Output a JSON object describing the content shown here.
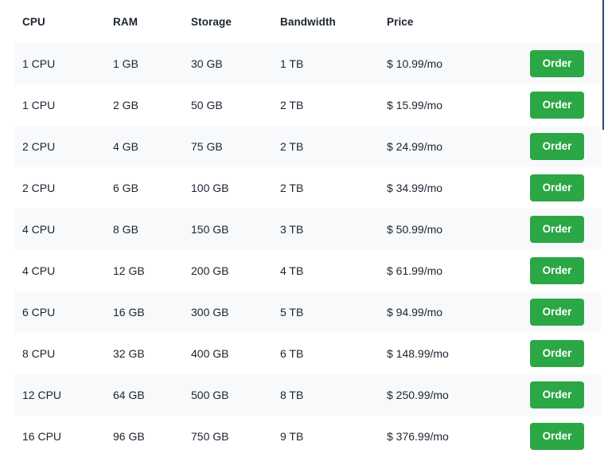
{
  "table": {
    "columns": [
      {
        "key": "cpu",
        "label": "CPU"
      },
      {
        "key": "ram",
        "label": "RAM"
      },
      {
        "key": "storage",
        "label": "Storage"
      },
      {
        "key": "bandwidth",
        "label": "Bandwidth"
      },
      {
        "key": "price",
        "label": "Price"
      },
      {
        "key": "action",
        "label": ""
      }
    ],
    "order_button_label": "Order",
    "rows": [
      {
        "cpu": "1 CPU",
        "ram": "1 GB",
        "storage": "30 GB",
        "bandwidth": "1 TB",
        "price": "$ 10.99/mo",
        "action": "Order"
      },
      {
        "cpu": "1 CPU",
        "ram": "2 GB",
        "storage": "50 GB",
        "bandwidth": "2 TB",
        "price": "$ 15.99/mo",
        "action": "Order"
      },
      {
        "cpu": "2 CPU",
        "ram": "4 GB",
        "storage": "75 GB",
        "bandwidth": "2 TB",
        "price": "$ 24.99/mo",
        "action": "Order"
      },
      {
        "cpu": "2 CPU",
        "ram": "6 GB",
        "storage": "100 GB",
        "bandwidth": "2 TB",
        "price": "$ 34.99/mo",
        "action": "Order"
      },
      {
        "cpu": "4 CPU",
        "ram": "8 GB",
        "storage": "150 GB",
        "bandwidth": "3 TB",
        "price": "$ 50.99/mo",
        "action": "Order"
      },
      {
        "cpu": "4 CPU",
        "ram": "12 GB",
        "storage": "200 GB",
        "bandwidth": "4 TB",
        "price": "$ 61.99/mo",
        "action": "Order"
      },
      {
        "cpu": "6 CPU",
        "ram": "16 GB",
        "storage": "300 GB",
        "bandwidth": "5 TB",
        "price": "$ 94.99/mo",
        "action": "Order"
      },
      {
        "cpu": "8 CPU",
        "ram": "32 GB",
        "storage": "400 GB",
        "bandwidth": "6 TB",
        "price": "$ 148.99/mo",
        "action": "Order"
      },
      {
        "cpu": "12 CPU",
        "ram": "64 GB",
        "storage": "500 GB",
        "bandwidth": "8 TB",
        "price": "$ 250.99/mo",
        "action": "Order"
      },
      {
        "cpu": "16 CPU",
        "ram": "96 GB",
        "storage": "750 GB",
        "bandwidth": "9 TB",
        "price": "$ 376.99/mo",
        "action": "Order"
      }
    ]
  },
  "colors": {
    "accent_green": "#2ba745",
    "text_dark": "#1b2430",
    "row_stripe": "#f8f9fa",
    "row_plain": "#ffffff",
    "scrollbar_thumb": "#2c4a72"
  },
  "scrollbar": {
    "orientation": "vertical",
    "thumb_position": "top"
  }
}
